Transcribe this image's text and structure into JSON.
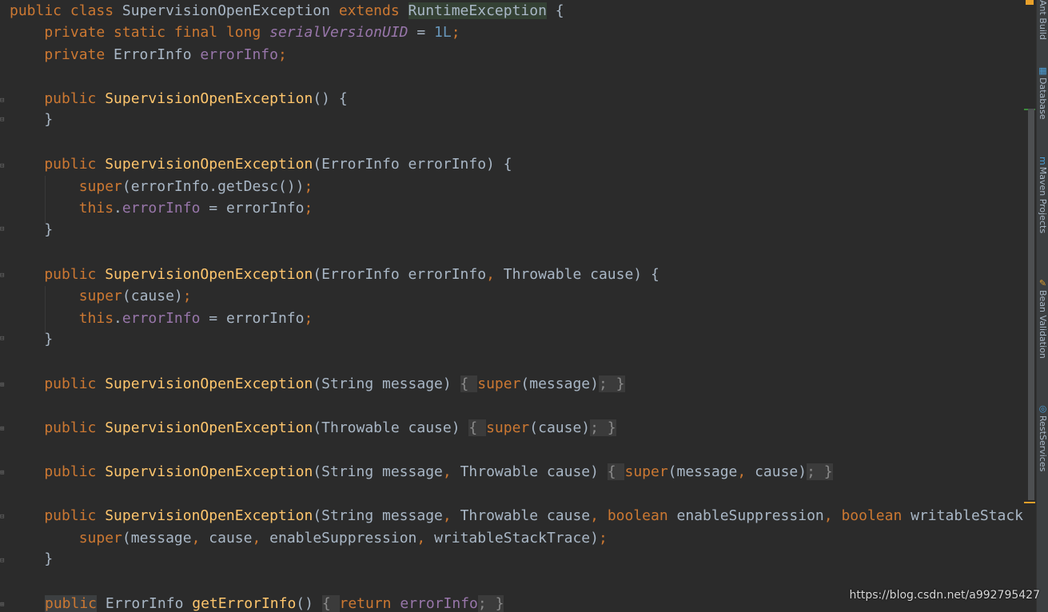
{
  "code": {
    "l1": {
      "kw1": "public class ",
      "cls": "SupervisionOpenException",
      "kw2": " extends ",
      "parent": "RuntimeException",
      "tail": " {"
    },
    "l2": {
      "kw": "    private static final long ",
      "name": "serialVersionUID",
      "eq": " = ",
      "num": "1L",
      "semi": ";"
    },
    "l3": {
      "kw": "    private ",
      "type": "ErrorInfo ",
      "name": "errorInfo",
      "semi": ";"
    },
    "l5": {
      "kw": "    public ",
      "fn": "SupervisionOpenException",
      "tail": "() {"
    },
    "l6": {
      "text": "    }"
    },
    "l8": {
      "kw": "    public ",
      "fn": "SupervisionOpenException",
      "tail": "(ErrorInfo errorInfo) {"
    },
    "l9": {
      "kw": "        super",
      "mid": "(errorInfo.getDesc())",
      "semi": ";"
    },
    "l10": {
      "kw": "        this",
      "dot": ".",
      "fld": "errorInfo",
      "mid": " = errorInfo",
      "semi": ";"
    },
    "l11": {
      "text": "    }"
    },
    "l13": {
      "kw": "    public ",
      "fn": "SupervisionOpenException",
      "p1": "(ErrorInfo errorInfo",
      "comma": ", ",
      "p2": "Throwable cause) {"
    },
    "l14": {
      "kw": "        super",
      "mid": "(cause)",
      "semi": ";"
    },
    "l15": {
      "kw": "        this",
      "dot": ".",
      "fld": "errorInfo",
      "mid": " = errorInfo",
      "semi": ";"
    },
    "l16": {
      "text": "    }"
    },
    "l18": {
      "kw": "    public ",
      "fn": "SupervisionOpenException",
      "p": "(String message)",
      "ob": "{ ",
      "sup": "super",
      "mid": "(message)",
      "semi": ";",
      "cb": " }"
    },
    "l20": {
      "kw": "    public ",
      "fn": "SupervisionOpenException",
      "p": "(Throwable cause)",
      "ob": "{ ",
      "sup": "super",
      "mid": "(cause)",
      "semi": ";",
      "cb": " }"
    },
    "l22": {
      "kw": "    public ",
      "fn": "SupervisionOpenException",
      "p1": "(String message",
      "comma": ", ",
      "p2": "Throwable cause)",
      "ob": "{ ",
      "sup": "super",
      "mid1": "(message",
      "comma2": ", ",
      "mid2": "cause)",
      "semi": ";",
      "cb": " }"
    },
    "l24": {
      "kw": "    public ",
      "fn": "SupervisionOpenException",
      "p1": "(String message",
      "c1": ", ",
      "p2": "Throwable cause",
      "c2": ", ",
      "b1": "boolean",
      "p3": " enableSuppression",
      "c3": ", ",
      "b2": "boolean",
      "p4": " writableStack"
    },
    "l25": {
      "kw": "        super",
      "p1": "(message",
      "c1": ", ",
      "p2": "cause",
      "c2": ", ",
      "p3": "enableSuppression",
      "c3": ", ",
      "p4": "writableStackTrace)",
      "semi": ";"
    },
    "l26": {
      "text": "    }"
    },
    "l28": {
      "kw": "public",
      "type": " ErrorInfo ",
      "fn": "getErrorInfo",
      "paren": "() ",
      "ob": "{ ",
      "ret": "return ",
      "fld": "errorInfo",
      "semi": ";",
      "cb": " }"
    }
  },
  "side_tabs": [
    {
      "label": "Ant Build",
      "icon": "ant-icon"
    },
    {
      "label": "Database",
      "icon": "database-icon"
    },
    {
      "label": "Maven Projects",
      "icon": "maven-icon"
    },
    {
      "label": "Bean Validation",
      "icon": "bean-validation-icon"
    },
    {
      "label": "RestServices",
      "icon": "rest-services-icon"
    }
  ],
  "watermark": "https://blog.csdn.net/a992795427",
  "colors": {
    "background": "#2b2b2b",
    "keyword": "#cc7832",
    "method": "#ffc66d",
    "field": "#9876aa",
    "number": "#6897bb",
    "text": "#a9b7c6"
  }
}
